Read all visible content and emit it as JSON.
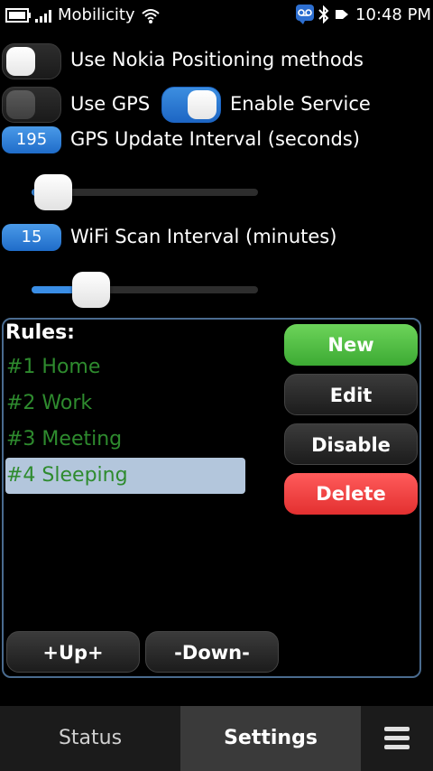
{
  "status_bar": {
    "carrier": "Mobilicity",
    "time": "10:48 PM",
    "icons": [
      "battery-icon",
      "signal-icon",
      "wifi-icon",
      "voicemail-icon",
      "bluetooth-icon",
      "notification-icon"
    ]
  },
  "settings": {
    "nokia_positioning": {
      "label": "Use Nokia Positioning methods",
      "enabled": false
    },
    "use_gps": {
      "label": "Use GPS",
      "enabled": false
    },
    "enable_service": {
      "label": "Enable Service",
      "enabled": true
    },
    "gps_interval": {
      "value": "195",
      "label": "GPS Update Interval (seconds)",
      "slider_fraction": 0.05
    },
    "wifi_interval": {
      "value": "15",
      "label": "WiFi Scan Interval (minutes)",
      "slider_fraction": 0.22
    }
  },
  "rules": {
    "title": "Rules:",
    "items": [
      "#1 Home",
      "#2 Work",
      "#3 Meeting",
      "#4 Sleeping"
    ],
    "selected_index": 3,
    "buttons": {
      "new": "New",
      "edit": "Edit",
      "disable": "Disable",
      "delete": "Delete",
      "up": "+Up+",
      "down": "-Down-"
    }
  },
  "tabs": {
    "status": "Status",
    "settings": "Settings",
    "active": "Settings"
  },
  "colors": {
    "accent": "#1f6cc9",
    "rule_text": "#2e8b2e",
    "selection": "#b3c6dc",
    "new_button": "#3caa33",
    "delete_button": "#e33030"
  }
}
